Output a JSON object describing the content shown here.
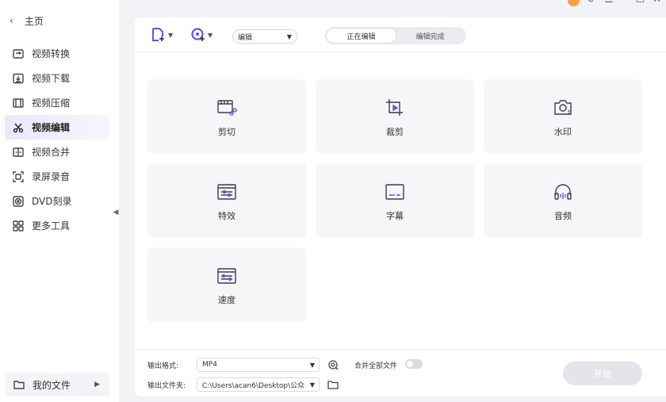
{
  "sidebar": {
    "home_label": "主页",
    "items": [
      {
        "label": "视频转换",
        "icon": "convert-icon"
      },
      {
        "label": "视频下载",
        "icon": "download-icon"
      },
      {
        "label": "视频压缩",
        "icon": "compress-icon"
      },
      {
        "label": "视频编辑",
        "icon": "scissors-icon",
        "active": true
      },
      {
        "label": "视频合并",
        "icon": "merge-icon"
      },
      {
        "label": "录屏录音",
        "icon": "record-icon"
      },
      {
        "label": "DVD刻录",
        "icon": "disc-icon"
      },
      {
        "label": "更多工具",
        "icon": "grid-icon"
      }
    ],
    "my_files_label": "我的文件"
  },
  "toolbar": {
    "add_file_icon": "add-file-icon",
    "add_media_icon": "add-media-icon",
    "mode_select_value": "编辑",
    "tabs": [
      {
        "label": "正在编辑",
        "active": true
      },
      {
        "label": "编辑完成",
        "active": false
      }
    ]
  },
  "tools": [
    {
      "label": "剪切",
      "icon": "cut-icon"
    },
    {
      "label": "裁剪",
      "icon": "crop-icon"
    },
    {
      "label": "水印",
      "icon": "watermark-icon"
    },
    {
      "label": "特效",
      "icon": "effects-icon"
    },
    {
      "label": "字幕",
      "icon": "subtitle-icon"
    },
    {
      "label": "音频",
      "icon": "headphones-icon"
    },
    {
      "label": "速度",
      "icon": "speed-icon"
    }
  ],
  "bottom": {
    "format_label": "输出格式:",
    "format_value": "MP4",
    "merge_label": "合并全部文件",
    "folder_label": "输出文件夹:",
    "folder_value": "C:\\Users\\acan6\\Desktop\\公众",
    "start_label": "开始"
  },
  "colors": {
    "accent": "#6a4ff0",
    "active_nav_bg": "#ece7fb",
    "start_disabled": "#e3e5ea"
  }
}
